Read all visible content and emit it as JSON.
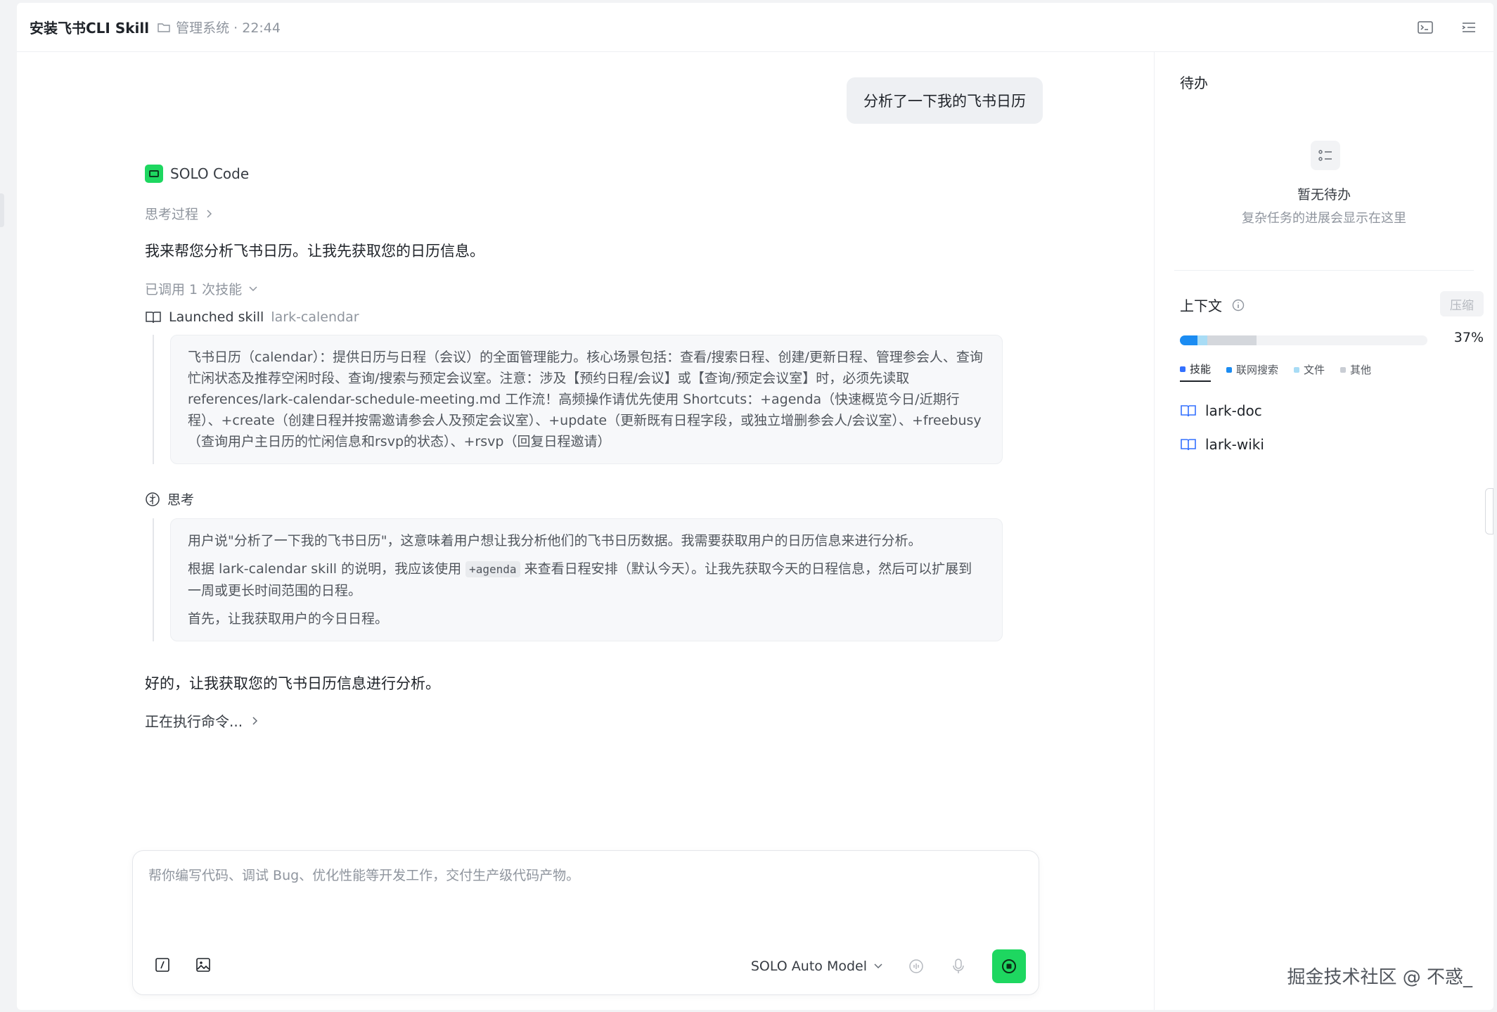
{
  "header": {
    "title": "安装飞书CLI Skill",
    "meta": "管理系统 · 22:44"
  },
  "chat": {
    "user_message": "分析了一下我的飞书日历",
    "agent_name": "SOLO Code",
    "thinking_label": "思考过程",
    "para1": "我来帮您分析飞书日历。让我先获取您的日历信息。",
    "skill_count_label": "已调用 1 次技能",
    "launched_label": "Launched skill",
    "launched_skill": "lark-calendar",
    "skill_desc": "飞书日历（calendar）：提供日历与日程（会议）的全面管理能力。核心场景包括：查看/搜索日程、创建/更新日程、管理参会人、查询忙闲状态及推荐空闲时段、查询/搜索与预定会议室。注意：涉及【预约日程/会议】或【查询/预定会议室】时，必须先读取references/lark-calendar-schedule-meeting.md 工作流！高频操作请优先使用 Shortcuts：+agenda（快速概览今日/近期行程）、+create（创建日程并按需邀请参会人及预定会议室）、+update（更新既有日程字段，或独立增删参会人/会议室）、+freebusy（查询用户主日历的忙闲信息和rsvp的状态）、+rsvp（回复日程邀请）",
    "think_label": "思考",
    "think_p1": "用户说\"分析了一下我的飞书日历\"，这意味着用户想让我分析他们的飞书日历数据。我需要获取用户的日历信息来进行分析。",
    "think_p2_before": "根据 lark-calendar skill 的说明，我应该使用",
    "think_p2_code": "+agenda",
    "think_p2_after": "来查看日程安排（默认今天）。让我先获取今天的日程信息，然后可以扩展到一周或更长时间范围的日程。",
    "think_p3": "首先，让我获取用户的今日日程。",
    "para2": "好的，让我获取您的飞书日历信息进行分析。",
    "running_label": "正在执行命令..."
  },
  "composer": {
    "placeholder": "帮你编写代码、调试 Bug、优化性能等开发工作，交付生产级代码产物。",
    "model": "SOLO Auto Model"
  },
  "todo": {
    "title": "待办",
    "empty_title": "暂无待办",
    "empty_sub": "复杂任务的进展会显示在这里"
  },
  "context": {
    "title": "上下文",
    "compress": "压缩",
    "percent_label": "37%",
    "percent": 37,
    "segments": [
      {
        "name": "技能",
        "percent": 7,
        "color": "#1b8cf2"
      },
      {
        "name": "联网搜索",
        "percent": 4,
        "color": "#a8dcf5"
      },
      {
        "name": "文件",
        "percent": 0,
        "color": "#c9e8f7"
      },
      {
        "name": "其他",
        "percent": 20,
        "color": "#d4d7dc"
      }
    ],
    "legend": [
      {
        "label": "技能",
        "color": "#3370ff"
      },
      {
        "label": "联网搜索",
        "color": "#1b8cf2"
      },
      {
        "label": "文件",
        "color": "#a8dcf5"
      },
      {
        "label": "其他",
        "color": "#c9cdd4"
      }
    ],
    "items": [
      "lark-doc",
      "lark-wiki"
    ]
  },
  "watermark": "掘金技术社区 @ 不惑_"
}
